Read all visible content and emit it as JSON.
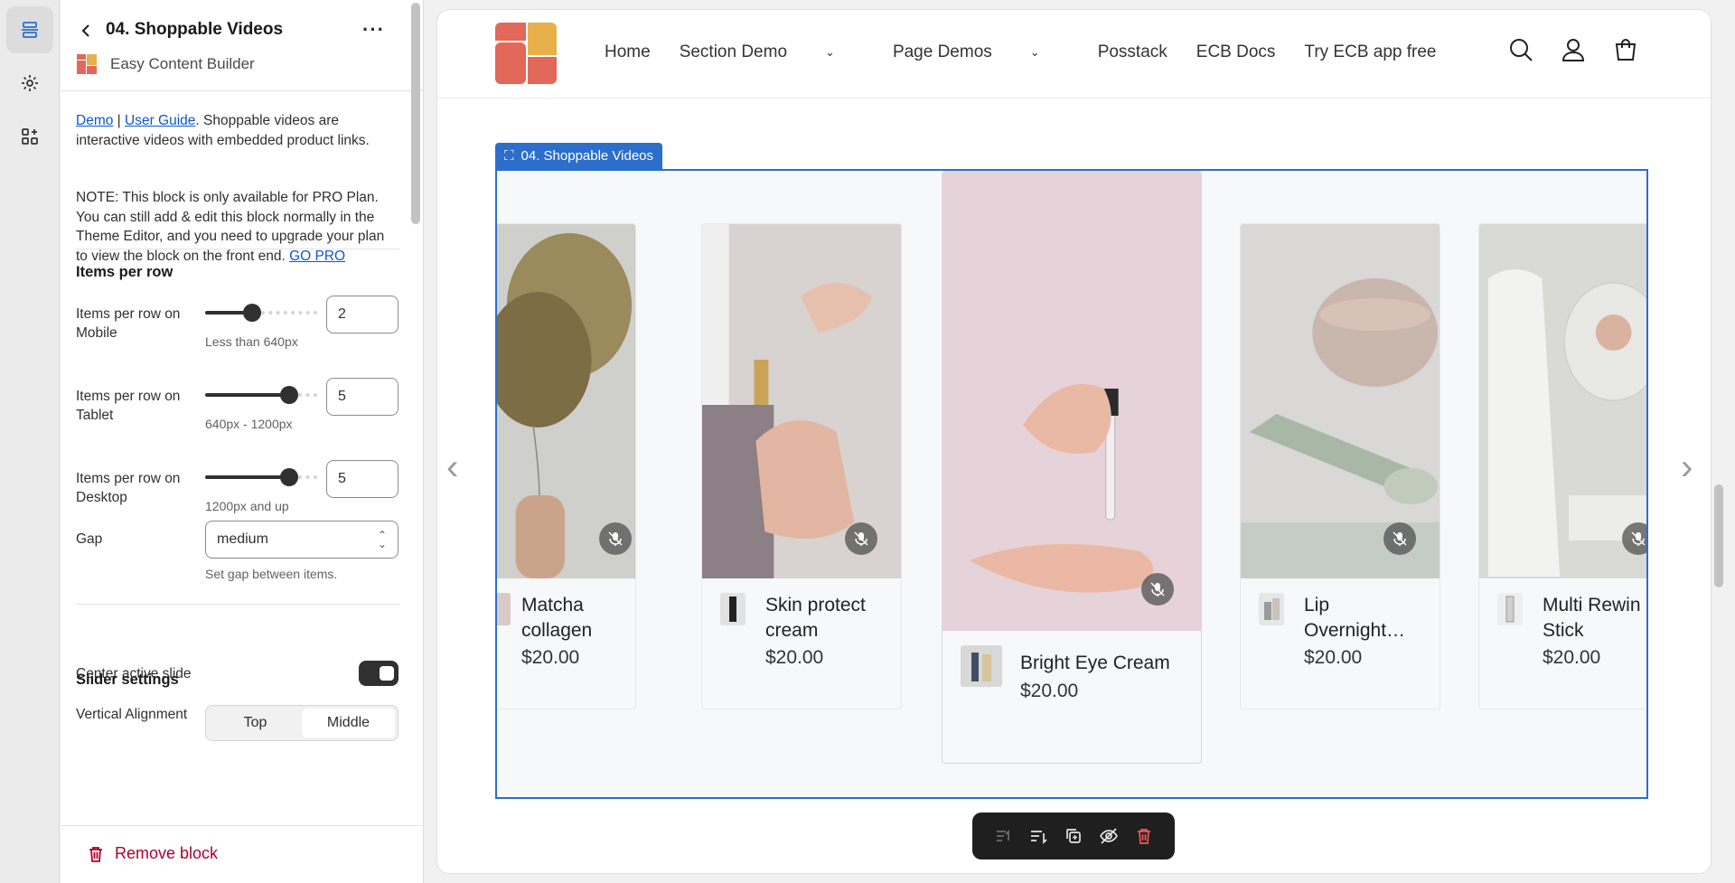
{
  "rail": {
    "items": [
      "sections-icon",
      "settings-icon",
      "apps-icon"
    ]
  },
  "panel": {
    "title": "04. Shoppable Videos",
    "app_name": "Easy Content Builder",
    "desc_link_demo": "Demo",
    "desc_sep": "|",
    "desc_link_guide": "User Guide",
    "desc_text": ". Shoppable videos are interactive videos with embedded product links.",
    "note_text": "NOTE: This block is only available for PRO Plan. You can still add & edit this block normally in the Theme Editor, and you need to upgrade your plan to view the block on the front end.",
    "note_link": "GO PRO",
    "items_per_row": {
      "title": "Items per row",
      "mobile": {
        "label": "Items per row on Mobile",
        "value": "2",
        "hint": "Less than 640px",
        "fraction": 0.4
      },
      "tablet": {
        "label": "Items per row on Tablet",
        "value": "5",
        "hint": "640px - 1200px",
        "fraction": 0.8
      },
      "desktop": {
        "label": "Items per row on Desktop",
        "value": "5",
        "hint": "1200px and up",
        "fraction": 0.8
      }
    },
    "gap": {
      "label": "Gap",
      "value": "medium",
      "hint": "Set gap between items."
    },
    "slider_settings": {
      "title": "Slider settings",
      "center_label": "Center active slide",
      "center_on": true,
      "vertical_label": "Vertical Alignment",
      "vertical_options": [
        "Top",
        "Middle"
      ],
      "vertical_selected": "Middle"
    },
    "remove_label": "Remove block"
  },
  "store": {
    "nav": [
      "Home",
      "Section Demo",
      "Page Demos",
      "Posstack",
      "ECB Docs",
      "Try ECB app free"
    ],
    "section_badge": "04. Shoppable Videos",
    "products": [
      {
        "name": "Matcha collagen",
        "price": "$20.00"
      },
      {
        "name": "Skin protect cream",
        "price": "$20.00"
      },
      {
        "name": "Bright Eye Cream",
        "price": "$20.00"
      },
      {
        "name": "Lip Overnight…",
        "price": "$20.00"
      },
      {
        "name": "Multi Rewin Stick",
        "price": "$20.00"
      }
    ]
  },
  "colors": {
    "accent": "#2c6ecb",
    "danger": "#b0002b",
    "logo_red": "#e2685a",
    "logo_yellow": "#e8b04b"
  }
}
